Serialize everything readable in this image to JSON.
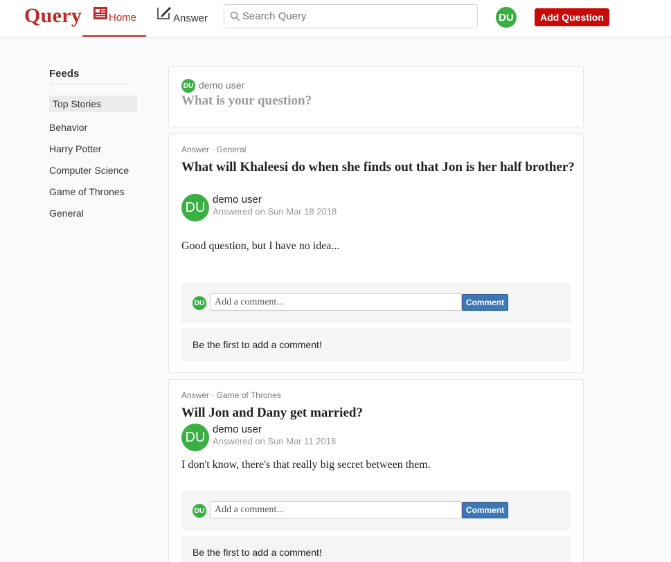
{
  "header": {
    "logo": "Query",
    "nav_home": "Home",
    "nav_answer": "Answer",
    "search_placeholder": "Search Query",
    "avatar_initials": "DU",
    "add_question": "Add Question"
  },
  "colors": {
    "brand": "#b92b27",
    "add_question_bg": "#c60a0a",
    "avatar_green": "#3aaf43",
    "comment_button": "#3e78b3"
  },
  "sidebar": {
    "title": "Feeds",
    "items": [
      {
        "label": "Top Stories",
        "active": true
      },
      {
        "label": "Behavior"
      },
      {
        "label": "Harry Potter"
      },
      {
        "label": "Computer Science"
      },
      {
        "label": "Game of Thrones"
      },
      {
        "label": "General"
      }
    ]
  },
  "ask": {
    "avatar": "DU",
    "user": "demo user",
    "prompt": "What is your question?"
  },
  "questions": [
    {
      "meta": "Answer · General",
      "title": "What will Khaleesi do when she finds out that Jon is her half brother?",
      "author_avatar": "DU",
      "author": "demo user",
      "answered": "Answered on Sun Mar 18 2018",
      "answer": "Good question, but I have no idea...",
      "comment_avatar": "DU",
      "comment_placeholder": "Add a comment...",
      "comment_button": "Comment",
      "first_comment": "Be the first to add a comment!"
    },
    {
      "meta": "Answer · Game of Thrones",
      "title": "Will Jon and Dany get married?",
      "author_avatar": "DU",
      "author": "demo user",
      "answered": "Answered on Sun Mar 11 2018",
      "answer": "I don't know, there's that really big secret between them.",
      "comment_avatar": "DU",
      "comment_placeholder": "Add a comment...",
      "comment_button": "Comment",
      "first_comment": "Be the first to add a comment!"
    }
  ]
}
